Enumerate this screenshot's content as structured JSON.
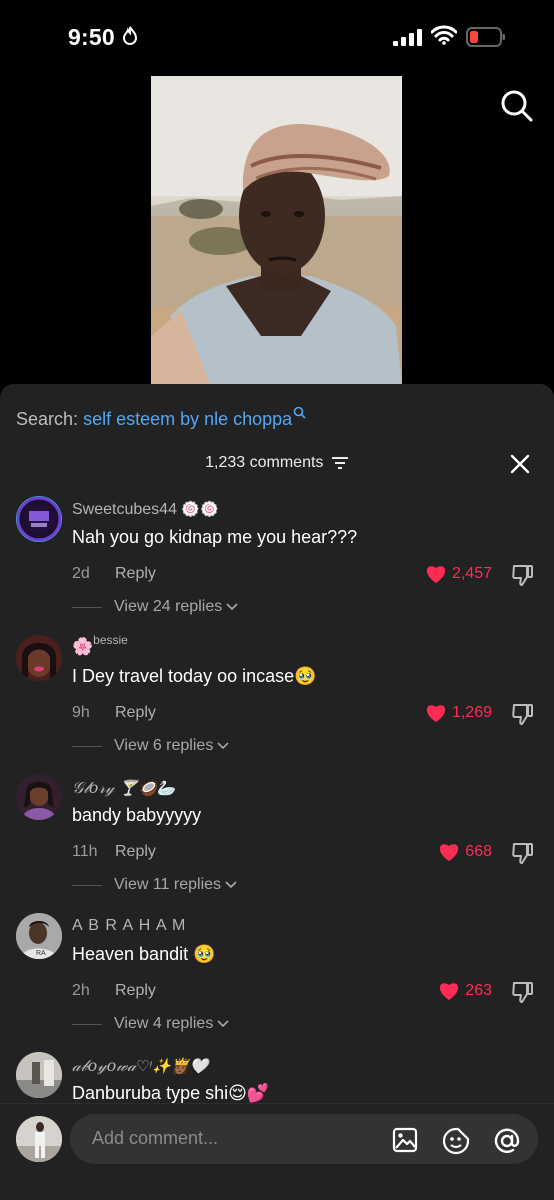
{
  "status_bar": {
    "time": "9:50"
  },
  "search": {
    "prefix": "Search:",
    "query": "self esteem by nle choppa"
  },
  "comments_header": {
    "count_label": "1,233 comments"
  },
  "comments": [
    {
      "username": "Sweetcubes44",
      "badges": "🍥🍥",
      "text": "Nah you go kidnap me you hear???",
      "time": "2d",
      "reply": "Reply",
      "likes": "2,457",
      "view_replies": "View 24 replies"
    },
    {
      "username": "bessie",
      "badges": "🌸",
      "text": "I Dey travel today oo incase🥹",
      "time": "9h",
      "reply": "Reply",
      "likes": "1,269",
      "view_replies": "View 6 replies"
    },
    {
      "username": "𝒢𝓁𝑜𝓇𝓎",
      "badges": "🍸🥥🦢",
      "text": "bandy babyyyyy",
      "time": "11h",
      "reply": "Reply",
      "likes": "668",
      "view_replies": "View 11 replies"
    },
    {
      "username": "A B R A H A M",
      "badges": "",
      "text": "Heaven bandit 🥹",
      "time": "2h",
      "reply": "Reply",
      "likes": "263",
      "view_replies": "View 4 replies"
    },
    {
      "username": "𝒶𝒷𝑜𝓎𝑜𝓌𝒶",
      "badges": "♡ᵎ✨👸🏾🤍",
      "text": "Danburuba type shi😌💕",
      "time": "",
      "reply": "",
      "likes": "",
      "view_replies": ""
    }
  ],
  "composer": {
    "placeholder": "Add comment..."
  },
  "colors": {
    "accent_like": "#fe2c55",
    "link_blue": "#52a7f5",
    "panel_bg": "#222222"
  },
  "icons": [
    "search-icon",
    "filter-icon",
    "close-icon",
    "heart-icon",
    "dislike-icon",
    "chevron-down-icon",
    "image-icon",
    "emoji-icon",
    "mention-icon"
  ]
}
